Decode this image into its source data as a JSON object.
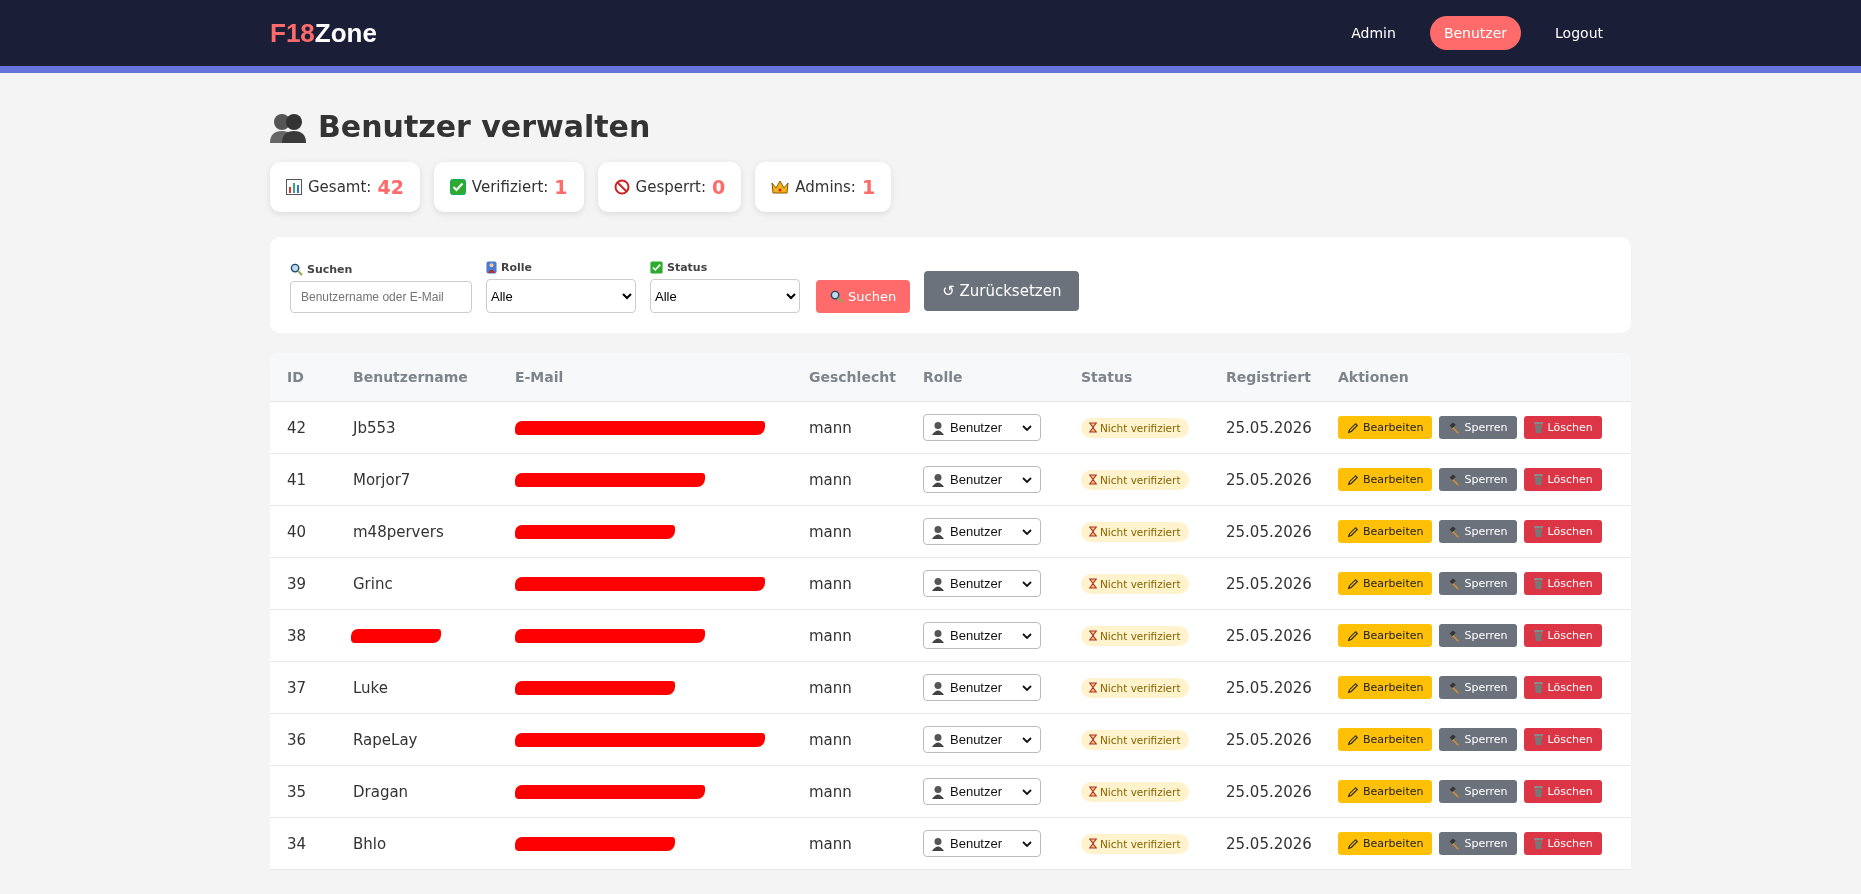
{
  "brand": {
    "accent": "F18",
    "rest": "Zone"
  },
  "nav": [
    {
      "label": "Admin",
      "selected": false
    },
    {
      "label": "Benutzer",
      "selected": true
    },
    {
      "label": "Logout",
      "selected": false
    }
  ],
  "page_title": "Benutzer verwalten",
  "stats": [
    {
      "kind": "chart",
      "label": "Gesamt:",
      "value": "42"
    },
    {
      "kind": "check",
      "label": "Verifiziert:",
      "value": "1"
    },
    {
      "kind": "blocked",
      "label": "Gesperrt:",
      "value": "0"
    },
    {
      "kind": "crown",
      "label": "Admins:",
      "value": "1"
    }
  ],
  "filters": {
    "search": {
      "label": "Suchen",
      "placeholder": "Benutzername oder E-Mail"
    },
    "role": {
      "label": "Rolle",
      "value": "Alle"
    },
    "status": {
      "label": "Status",
      "value": "Alle"
    },
    "search_button": "Suchen",
    "reset_button": "↺ Zurücksetzen"
  },
  "table": {
    "columns": [
      "ID",
      "Benutzername",
      "E-Mail",
      "Geschlecht",
      "Rolle",
      "Status",
      "Registriert",
      "Aktionen"
    ],
    "rows": [
      {
        "id": "42",
        "username": "Jb553",
        "username_redacted": false,
        "email_redacted": true,
        "gender": "mann",
        "role": "Benutzer",
        "status": "Nicht verifiziert",
        "registered": "25.05.2026",
        "actions": [
          "Bearbeiten",
          "Sperren",
          "Löschen"
        ]
      },
      {
        "id": "41",
        "username": "Morjor7",
        "username_redacted": false,
        "email_redacted": true,
        "gender": "mann",
        "role": "Benutzer",
        "status": "Nicht verifiziert",
        "registered": "25.05.2026",
        "actions": [
          "Bearbeiten",
          "Sperren",
          "Löschen"
        ]
      },
      {
        "id": "40",
        "username": "m48pervers",
        "username_redacted": false,
        "email_redacted": true,
        "gender": "mann",
        "role": "Benutzer",
        "status": "Nicht verifiziert",
        "registered": "25.05.2026",
        "actions": [
          "Bearbeiten",
          "Sperren",
          "Löschen"
        ]
      },
      {
        "id": "39",
        "username": "Grinc",
        "username_redacted": false,
        "email_redacted": true,
        "gender": "mann",
        "role": "Benutzer",
        "status": "Nicht verifiziert",
        "registered": "25.05.2026",
        "actions": [
          "Bearbeiten",
          "Sperren",
          "Löschen"
        ]
      },
      {
        "id": "38",
        "username_redacted": true,
        "email_redacted": true,
        "gender": "mann",
        "role": "Benutzer",
        "status": "Nicht verifiziert",
        "registered": "25.05.2026",
        "actions": [
          "Bearbeiten",
          "Sperren",
          "Löschen"
        ]
      },
      {
        "id": "37",
        "username": "Luke",
        "username_redacted": false,
        "email_redacted": true,
        "gender": "mann",
        "role": "Benutzer",
        "status": "Nicht verifiziert",
        "registered": "25.05.2026",
        "actions": [
          "Bearbeiten",
          "Sperren",
          "Löschen"
        ]
      },
      {
        "id": "36",
        "username": "RapeLay",
        "username_redacted": false,
        "email_redacted": true,
        "gender": "mann",
        "role": "Benutzer",
        "status": "Nicht verifiziert",
        "registered": "25.05.2026",
        "actions": [
          "Bearbeiten",
          "Sperren",
          "Löschen"
        ]
      },
      {
        "id": "35",
        "username": "Dragan",
        "username_redacted": false,
        "email_redacted": true,
        "gender": "mann",
        "role": "Benutzer",
        "status": "Nicht verifiziert",
        "registered": "25.05.2026",
        "actions": [
          "Bearbeiten",
          "Sperren",
          "Löschen"
        ]
      },
      {
        "id": "34",
        "username": "Bhlo",
        "username_redacted": false,
        "email_redacted": true,
        "gender": "mann",
        "role": "Benutzer",
        "status": "Nicht verifiziert",
        "registered": "25.05.2026",
        "actions": [
          "Bearbeiten",
          "Sperren",
          "Löschen"
        ]
      }
    ]
  }
}
